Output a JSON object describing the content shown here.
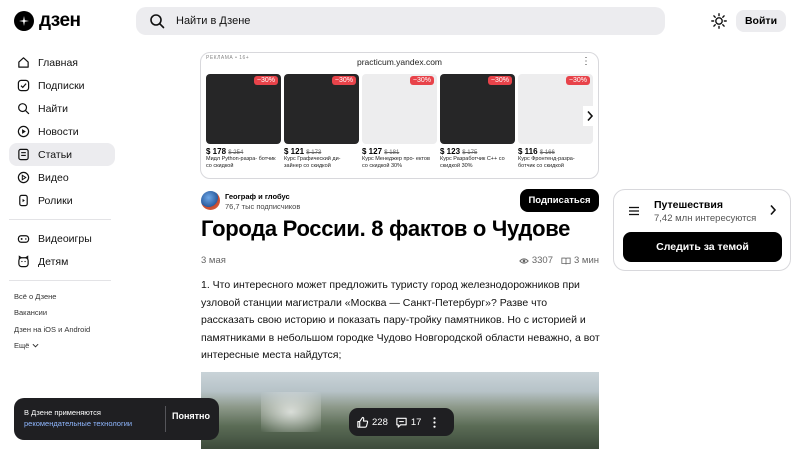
{
  "header": {
    "logo_text": "дзен",
    "search_placeholder": "Найти в Дзене",
    "login_label": "Войти"
  },
  "sidebar": {
    "items": [
      {
        "label": "Главная",
        "icon": "home-icon"
      },
      {
        "label": "Подписки",
        "icon": "subscriptions-icon"
      },
      {
        "label": "Найти",
        "icon": "search-icon"
      },
      {
        "label": "Новости",
        "icon": "news-icon"
      },
      {
        "label": "Статьи",
        "icon": "articles-icon",
        "active": true
      },
      {
        "label": "Видео",
        "icon": "video-icon"
      },
      {
        "label": "Ролики",
        "icon": "clips-icon"
      }
    ],
    "secondary_items": [
      {
        "label": "Видеоигры",
        "icon": "gamepad-icon"
      },
      {
        "label": "Детям",
        "icon": "kids-icon"
      }
    ],
    "footer_links": [
      "Всё о Дзене",
      "Вакансии",
      "Дзен на iOS и Android",
      "Ещё"
    ]
  },
  "ad": {
    "label": "РЕКЛАМА • 16+",
    "domain": "practicum.yandex.com",
    "cards": [
      {
        "discount": "−30%",
        "price": "$ 178",
        "old_price": "$ 254",
        "desc": "Мидл Python-разра- ботчик со скидкой",
        "theme": "dark"
      },
      {
        "discount": "−30%",
        "price": "$ 121",
        "old_price": "$ 173",
        "desc": "Курс Графический ди- зайнер со скидкой",
        "theme": "dark"
      },
      {
        "discount": "−30%",
        "price": "$ 127",
        "old_price": "$ 181",
        "desc": "Курс Менеджер про- ектов со скидкой 30%",
        "theme": "light"
      },
      {
        "discount": "−30%",
        "price": "$ 123",
        "old_price": "$ 175",
        "desc": "Курс Разработчик C++ со скидкой 30%",
        "theme": "dark"
      },
      {
        "discount": "−30%",
        "price": "$ 116",
        "old_price": "$ 166",
        "desc": "Курс Фронтенд-разра- ботчик со скидкой",
        "theme": "light"
      }
    ]
  },
  "channel": {
    "name": "Географ и глобус",
    "subscribers": "76,7 тыс подписчиков",
    "subscribe_label": "Подписаться"
  },
  "article": {
    "title": "Города России. 8 фактов о Чудове",
    "date": "3 мая",
    "views": "3307",
    "read_time": "3 мин",
    "body": "1. Что интересного может предложить туристу город железнодорожников при узловой станции магистрали «Москва — Санкт-Петербург»? Разве что рассказать свою историю и показать пару-тройку памятников. Но с историей и памятниками в небольшом городке Чудово Новгородской области неважно, а вот интересные места найдутся;"
  },
  "topic": {
    "name": "Путешествия",
    "interested": "7,42 млн интересуются",
    "follow_label": "Следить за темой"
  },
  "toast": {
    "text": "В Дзене применяются",
    "link": "рекомендательные технологии",
    "ok_label": "Понятно"
  },
  "actions": {
    "likes": "228",
    "comments": "17"
  }
}
